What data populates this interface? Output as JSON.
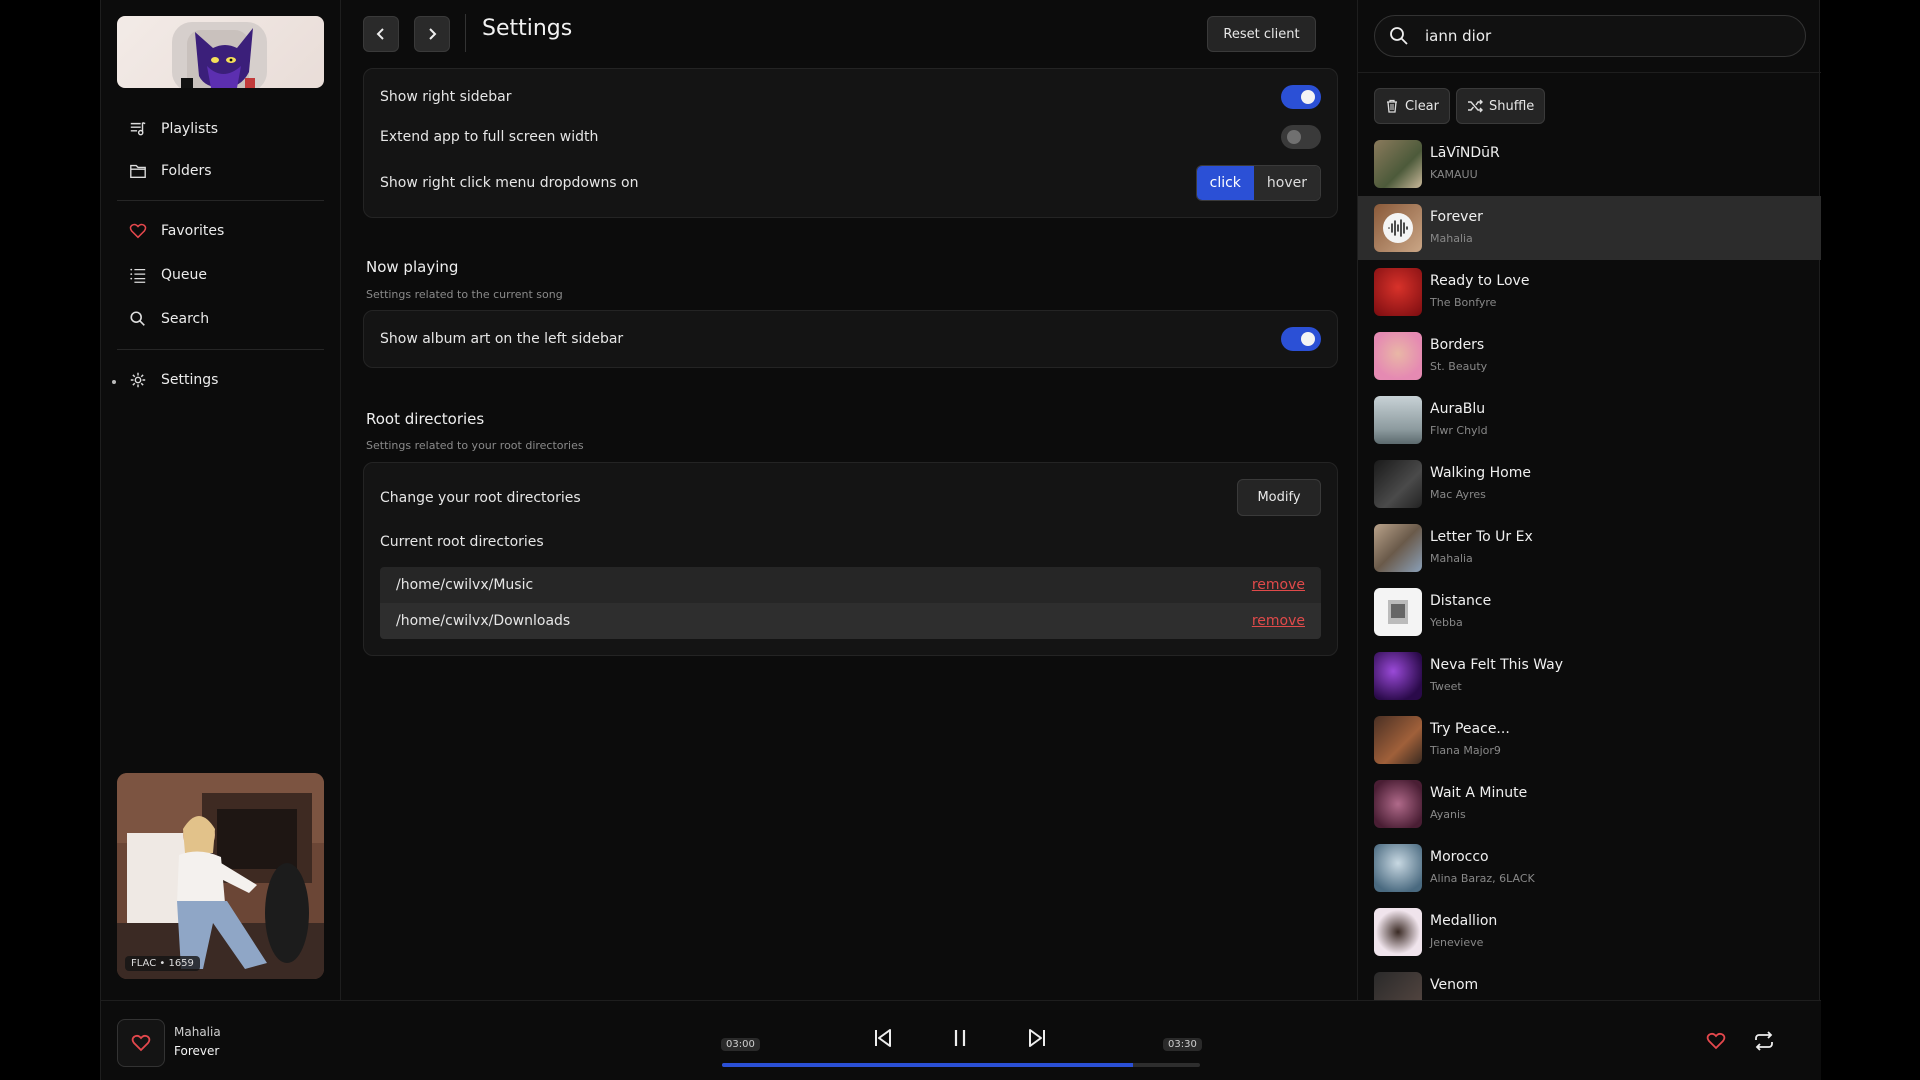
{
  "nav": {
    "items": [
      {
        "label": "Playlists",
        "icon": "playlist-icon"
      },
      {
        "label": "Folders",
        "icon": "folder-icon"
      },
      {
        "label": "Favorites",
        "icon": "heart-icon"
      },
      {
        "label": "Queue",
        "icon": "queue-list-icon"
      },
      {
        "label": "Search",
        "icon": "search-icon"
      },
      {
        "label": "Settings",
        "icon": "gear-icon",
        "active": true
      }
    ]
  },
  "album_art": {
    "format_badge": "FLAC • 1659"
  },
  "header": {
    "title": "Settings",
    "reset_label": "Reset client"
  },
  "settings": {
    "general": {
      "show_right_sidebar": {
        "label": "Show right sidebar",
        "enabled": true
      },
      "extend_full_width": {
        "label": "Extend app to full screen width",
        "enabled": false
      },
      "right_click_menu": {
        "label": "Show right click menu dropdowns on",
        "options": [
          "click",
          "hover"
        ],
        "selected": "click"
      }
    },
    "now_playing": {
      "title": "Now playing",
      "subtitle": "Settings related to the current song",
      "show_album_art": {
        "label": "Show album art on the left sidebar",
        "enabled": true
      }
    },
    "root_dirs": {
      "title": "Root directories",
      "subtitle": "Settings related to your root directories",
      "change_label": "Change your root directories",
      "modify_label": "Modify",
      "current_label": "Current root directories",
      "remove_label": "remove",
      "dirs": [
        "/home/cwilvx/Music",
        "/home/cwilvx/Downloads"
      ]
    }
  },
  "queue": {
    "search_value": "iann dior",
    "clear_label": "Clear",
    "shuffle_label": "Shuffle",
    "tracks": [
      {
        "title": "LāVīNDūR",
        "artist": "KAMAUU"
      },
      {
        "title": "Forever",
        "artist": "Mahalia",
        "current": true
      },
      {
        "title": "Ready to Love",
        "artist": "The Bonfyre"
      },
      {
        "title": "Borders",
        "artist": "St. Beauty"
      },
      {
        "title": "AuraBlu",
        "artist": "Flwr Chyld"
      },
      {
        "title": "Walking Home",
        "artist": "Mac Ayres"
      },
      {
        "title": "Letter To Ur Ex",
        "artist": "Mahalia"
      },
      {
        "title": "Distance",
        "artist": "Yebba"
      },
      {
        "title": "Neva Felt This Way",
        "artist": "Tweet"
      },
      {
        "title": "Try Peace...",
        "artist": "Tiana Major9"
      },
      {
        "title": "Wait A Minute",
        "artist": "Ayanis"
      },
      {
        "title": "Morocco",
        "artist": "Alina Baraz, 6LACK"
      },
      {
        "title": "Medallion",
        "artist": "Jenevieve"
      },
      {
        "title": "Venom",
        "artist": ""
      }
    ]
  },
  "player": {
    "artist": "Mahalia",
    "title": "Forever",
    "elapsed": "03:00",
    "duration": "03:30",
    "progress": 0.86
  },
  "colors": {
    "accent": "#2b50d6",
    "danger": "#e04a4a",
    "heart": "#e5484d"
  }
}
